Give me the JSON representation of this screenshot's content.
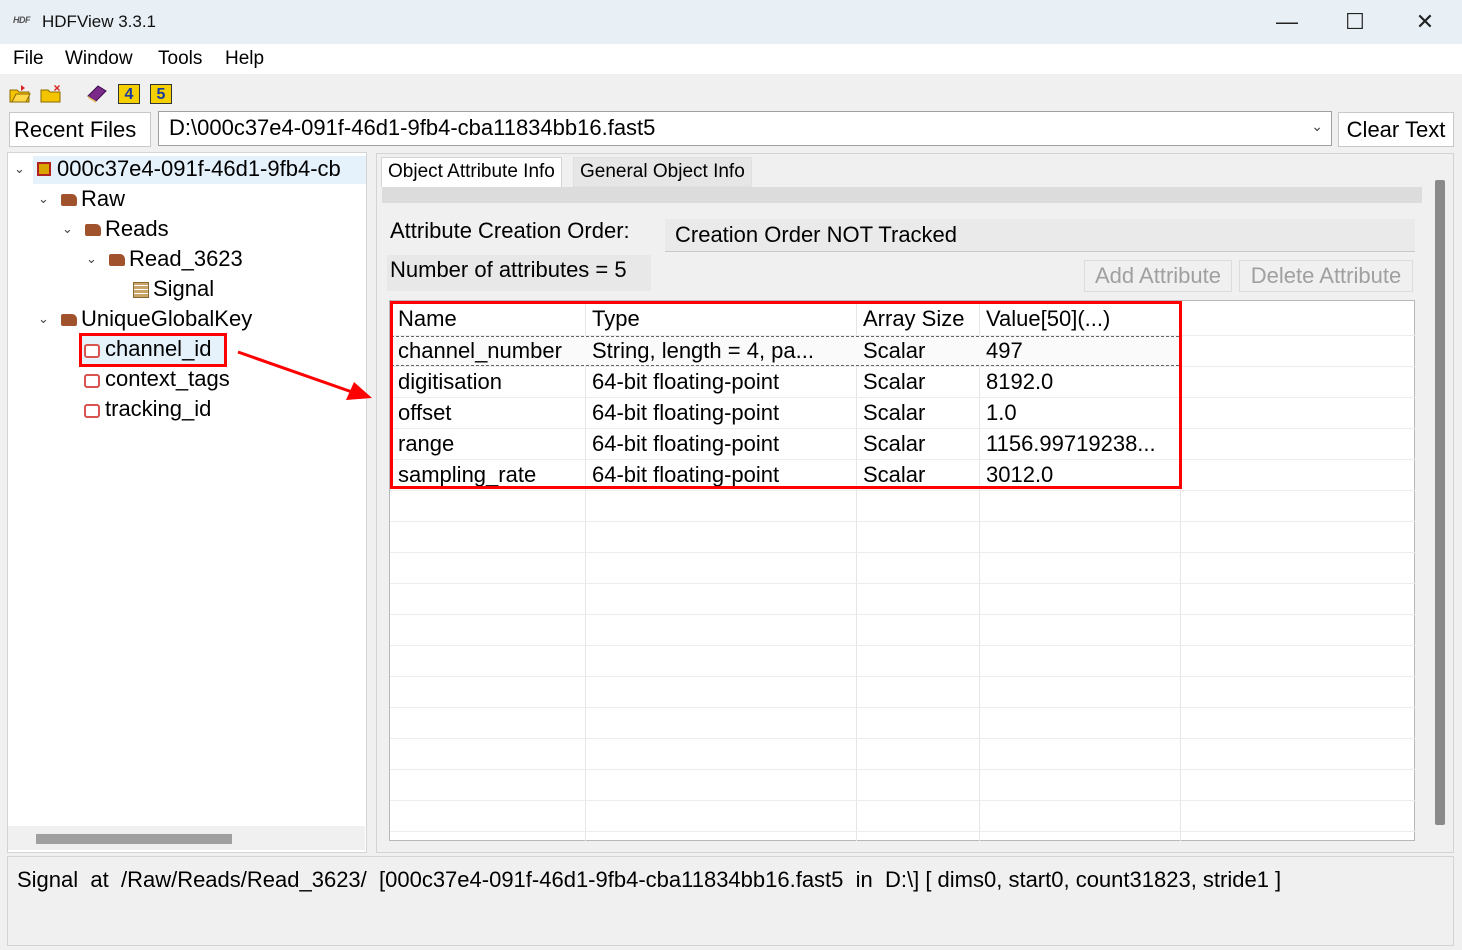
{
  "window": {
    "logo_text": "HDF",
    "title": "HDFView 3.3.1",
    "minimize_glyph": "—",
    "maximize_glyph": "☐",
    "close_glyph": "✕"
  },
  "menu": [
    "File",
    "Window",
    "Tools",
    "Help"
  ],
  "toolbar_icons": [
    "open-folder-icon",
    "new-folder-icon",
    "help-book-icon",
    "hdf4-icon",
    "hdf5-icon"
  ],
  "toolbar_glyphs": {
    "hdf4": "4",
    "hdf5": "5"
  },
  "recent": {
    "label": "Recent Files",
    "current_path": "D:\\000c37e4-091f-46d1-9fb4-cba11834bb16.fast5",
    "clear_label": "Clear Text"
  },
  "tree": {
    "chevron": "⌄",
    "root": "000c37e4-091f-46d1-9fb4-cb",
    "raw": "Raw",
    "reads": "Reads",
    "read": "Read_3623",
    "signal": "Signal",
    "unique": "UniqueGlobalKey",
    "channel_id": "channel_id",
    "context_tags": "context_tags",
    "tracking_id": "tracking_id"
  },
  "tabs": {
    "attr_info": "Object Attribute Info",
    "general_info": "General Object Info"
  },
  "attributes": {
    "creation_order_label": "Attribute Creation Order:",
    "creation_order_value": "Creation Order NOT Tracked",
    "count_label": "Number of attributes = 5",
    "add_button": "Add Attribute",
    "delete_button": "Delete Attribute",
    "columns": [
      "Name",
      "Type",
      "Array Size",
      "Value[50](...)"
    ],
    "rows": [
      [
        "channel_number",
        "String, length = 4, pa...",
        "Scalar",
        "497"
      ],
      [
        "digitisation",
        "64-bit floating-point",
        "Scalar",
        "8192.0"
      ],
      [
        "offset",
        "64-bit floating-point",
        "Scalar",
        "1.0"
      ],
      [
        "range",
        "64-bit floating-point",
        "Scalar",
        "1156.99719238..."
      ],
      [
        "sampling_rate",
        "64-bit floating-point",
        "Scalar",
        "3012.0"
      ]
    ]
  },
  "status": {
    "text": "Signal  at  /Raw/Reads/Read_3623/  [000c37e4-091f-46d1-9fb4-cba11834bb16.fast5  in  D:\\] [ dims0, start0, count31823, stride1 ]"
  },
  "colors": {
    "annotation_red": "#ff0000",
    "titlebar": "#e8f0f6",
    "selection": "#e5f1fb"
  }
}
